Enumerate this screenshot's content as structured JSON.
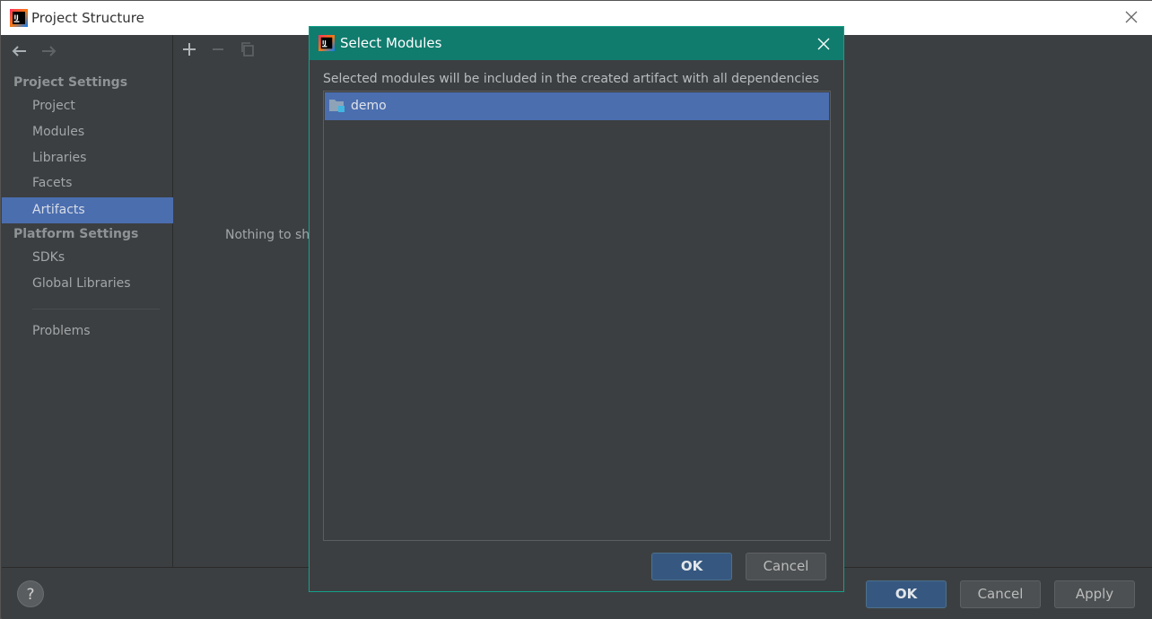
{
  "window": {
    "title": "Project Structure"
  },
  "sidebar": {
    "project_settings_header": "Project Settings",
    "project_items": [
      {
        "label": "Project"
      },
      {
        "label": "Modules"
      },
      {
        "label": "Libraries"
      },
      {
        "label": "Facets"
      },
      {
        "label": "Artifacts",
        "selected": true
      }
    ],
    "platform_settings_header": "Platform Settings",
    "platform_items": [
      {
        "label": "SDKs"
      },
      {
        "label": "Global Libraries"
      }
    ],
    "problems_label": "Problems"
  },
  "main": {
    "empty_text": "Nothing to sho"
  },
  "bottom": {
    "help_label": "?",
    "ok_label": "OK",
    "cancel_label": "Cancel",
    "apply_label": "Apply"
  },
  "dialog": {
    "title": "Select Modules",
    "description": "Selected modules will be included in the created artifact with all dependencies",
    "modules": [
      {
        "name": "demo",
        "selected": true
      }
    ],
    "ok_label": "OK",
    "cancel_label": "Cancel"
  },
  "colors": {
    "selection": "#4b6eaf",
    "dialog_title_bg": "#107c6e",
    "background": "#3c3f41",
    "primary_button": "#365880"
  }
}
